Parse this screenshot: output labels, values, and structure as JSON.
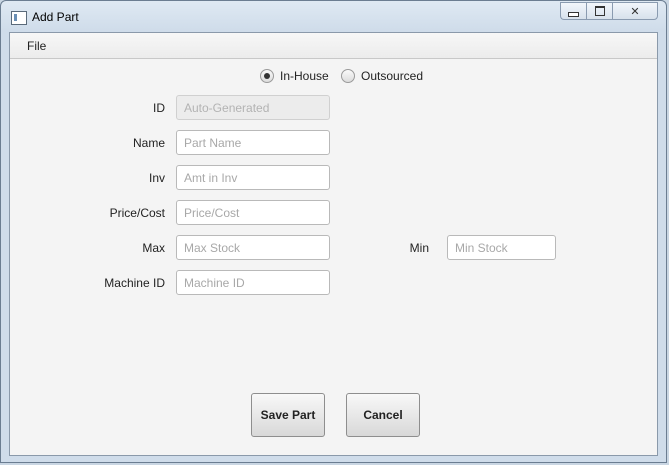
{
  "window": {
    "title": "Add Part",
    "icon": "app-window-icon"
  },
  "menu": {
    "file": "File"
  },
  "source_type": {
    "options": [
      {
        "label": "In-House",
        "checked": true
      },
      {
        "label": "Outsourced",
        "checked": false
      }
    ]
  },
  "form": {
    "id": {
      "label": "ID",
      "placeholder": "Auto-Generated"
    },
    "name": {
      "label": "Name",
      "placeholder": "Part Name"
    },
    "inv": {
      "label": "Inv",
      "placeholder": "Amt in Inv"
    },
    "price": {
      "label": "Price/Cost",
      "placeholder": "Price/Cost"
    },
    "max": {
      "label": "Max",
      "placeholder": "Max Stock"
    },
    "min": {
      "label": "Min",
      "placeholder": "Min Stock"
    },
    "machine_id": {
      "label": "Machine ID",
      "placeholder": "Machine ID"
    }
  },
  "buttons": {
    "save": "Save Part",
    "cancel": "Cancel"
  }
}
